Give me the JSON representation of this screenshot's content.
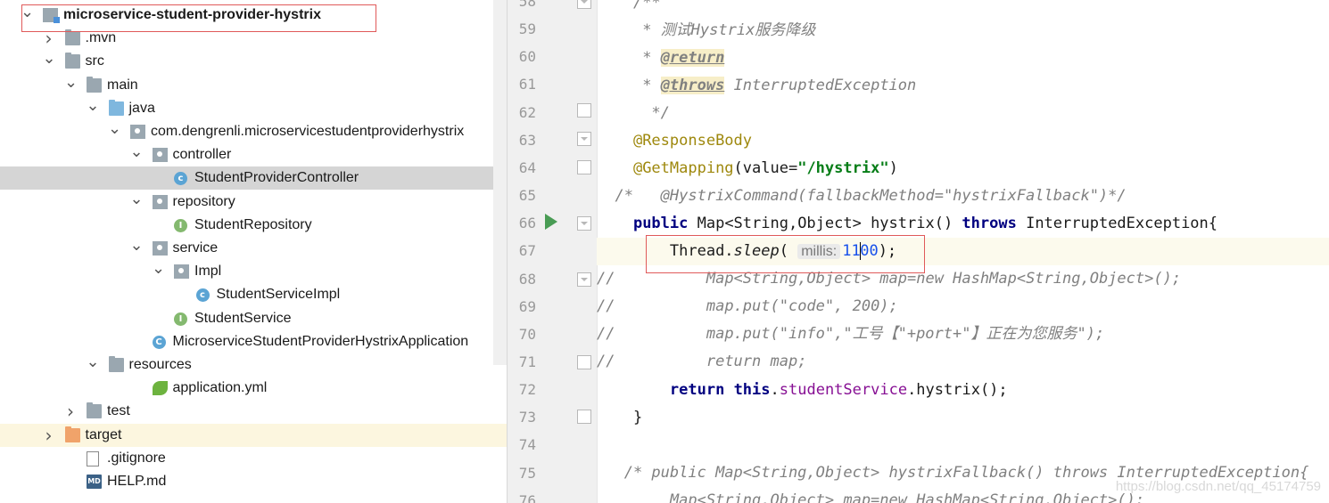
{
  "tree": {
    "items": [
      {
        "label": "microservice-student-provider-hystrix",
        "bold": true,
        "arrow": "v",
        "icon": "module-icon",
        "level": 0
      },
      {
        "label": ".mvn",
        "arrow": ">",
        "icon": "folder-icon",
        "level": 1
      },
      {
        "label": "src",
        "arrow": "v",
        "icon": "folder-icon",
        "level": 1
      },
      {
        "label": "main",
        "arrow": "v",
        "icon": "folder-icon",
        "level": 2
      },
      {
        "label": "java",
        "arrow": "v",
        "icon": "source-folder-icon",
        "level": 3
      },
      {
        "label": "com.dengrenli.microservicestudentproviderhystrix",
        "arrow": "v",
        "icon": "package-icon",
        "level": 4
      },
      {
        "label": "controller",
        "arrow": "v",
        "icon": "package-icon",
        "level": 5
      },
      {
        "label": "StudentProviderController",
        "arrow": "",
        "icon": "class-icon",
        "level": 6,
        "selected": true
      },
      {
        "label": "repository",
        "arrow": "v",
        "icon": "package-icon",
        "level": 5
      },
      {
        "label": "StudentRepository",
        "arrow": "",
        "icon": "interface-icon",
        "level": 6
      },
      {
        "label": "service",
        "arrow": "v",
        "icon": "package-icon",
        "level": 5
      },
      {
        "label": "Impl",
        "arrow": "v",
        "icon": "package-icon",
        "level": 6
      },
      {
        "label": "StudentServiceImpl",
        "arrow": "",
        "icon": "class-icon",
        "level": 7
      },
      {
        "label": "StudentService",
        "arrow": "",
        "icon": "interface-icon",
        "level": 6
      },
      {
        "label": "MicroserviceStudentProviderHystrixApplication",
        "arrow": "",
        "icon": "spring-app-icon",
        "level": 5
      },
      {
        "label": "resources",
        "arrow": "v",
        "icon": "resources-folder-icon",
        "level": 3
      },
      {
        "label": "application.yml",
        "arrow": "",
        "icon": "spring-yml-icon",
        "level": 5
      },
      {
        "label": "test",
        "arrow": ">",
        "icon": "folder-icon",
        "level": 2
      },
      {
        "label": "target",
        "arrow": ">",
        "icon": "target-folder-icon",
        "level": 1,
        "target": true
      },
      {
        "label": ".gitignore",
        "arrow": "",
        "icon": "file-icon",
        "level": 2
      },
      {
        "label": "HELP.md",
        "arrow": "",
        "icon": "markdown-icon",
        "level": 2
      }
    ]
  },
  "editor": {
    "lines": [
      {
        "n": "58",
        "code": "    /**"
      },
      {
        "n": "59",
        "code": "     * 测试Hystrix服务降级"
      },
      {
        "n": "60",
        "code": "     * @return"
      },
      {
        "n": "61",
        "code": "     * @throws InterruptedException"
      },
      {
        "n": "62",
        "code": "     */"
      },
      {
        "n": "63",
        "code": "    @ResponseBody"
      },
      {
        "n": "64",
        "code": "    @GetMapping(value=\"/hystrix\")"
      },
      {
        "n": "65",
        "code": "/*   @HystrixCommand(fallbackMethod=\"hystrixFallback\")*/"
      },
      {
        "n": "66",
        "code": "    public Map<String,Object> hystrix() throws InterruptedException{"
      },
      {
        "n": "67",
        "code": "        Thread.sleep( millis: 1100);"
      },
      {
        "n": "68",
        "code": "//       Map<String,Object> map=new HashMap<String,Object>();"
      },
      {
        "n": "69",
        "code": "//       map.put(\"code\", 200);"
      },
      {
        "n": "70",
        "code": "//       map.put(\"info\",\"工号【\"+port+\"】正在为您服务\");"
      },
      {
        "n": "71",
        "code": "//       return map;"
      },
      {
        "n": "72",
        "code": "        return this.studentService.hystrix();"
      },
      {
        "n": "73",
        "code": "    }"
      },
      {
        "n": "74",
        "code": ""
      },
      {
        "n": "75",
        "code": "    /* public Map<String,Object> hystrixFallback() throws InterruptedException{"
      },
      {
        "n": "76",
        "code": "        Map<String,Object> map=new HashMap<String,Object>();"
      }
    ],
    "tokens": {
      "l58": "/**",
      "l59": "* 测试Hystrix服务降级",
      "l60_star": "* ",
      "l60_tag": "@return",
      "l61_star": "* ",
      "l61_tag": "@throws",
      "l61_rest": " InterruptedException",
      "l62": "*/",
      "l63": "@ResponseBody",
      "l64_ann": "@GetMapping",
      "l64_a": "(value=",
      "l64_str": "\"/hystrix\"",
      "l64_b": ")",
      "l65": "/*   @HystrixCommand(fallbackMethod=\"hystrixFallback\")*/",
      "l66_kw1": "public",
      "l66_a": " Map<String,Object> hystrix() ",
      "l66_kw2": "throws",
      "l66_b": " InterruptedException{",
      "l67_a": "Thread.",
      "l67_m": "sleep",
      "l67_b": "( ",
      "l67_hint": "millis:",
      "l67_num1": "11",
      "l67_num2": "00",
      "l67_c": ");",
      "l68_a": "//",
      "l68_b": "Map<String,Object> map=new HashMap<String,Object>();",
      "l69_a": "//",
      "l69_b": "map.put(\"code\", 200);",
      "l70_a": "//",
      "l70_b": "map.put(\"info\",\"工号【\"+port+\"】正在为您服务\");",
      "l71_a": "//",
      "l71_b": "return map;",
      "l72_kw1": "return",
      "l72_kw2": "this",
      "l72_dot": ".",
      "l72_fld": "studentService",
      "l72_rest": ".hystrix();",
      "l73": "}",
      "l75": "/* public Map<String,Object> hystrixFallback() throws InterruptedException{",
      "l76": "Map<String,Object> map=new HashMap<String,Object>();"
    }
  },
  "watermark": "https://blog.csdn.net/qq_45174759",
  "colors": {
    "highlight_box": "#e05a5a",
    "selection": "#d5d5d5",
    "current_line": "#fcfaed",
    "keyword": "#000080",
    "string": "#067d17",
    "annotation": "#9e880d",
    "comment": "#808080",
    "field": "#871094",
    "number": "#1750eb"
  }
}
